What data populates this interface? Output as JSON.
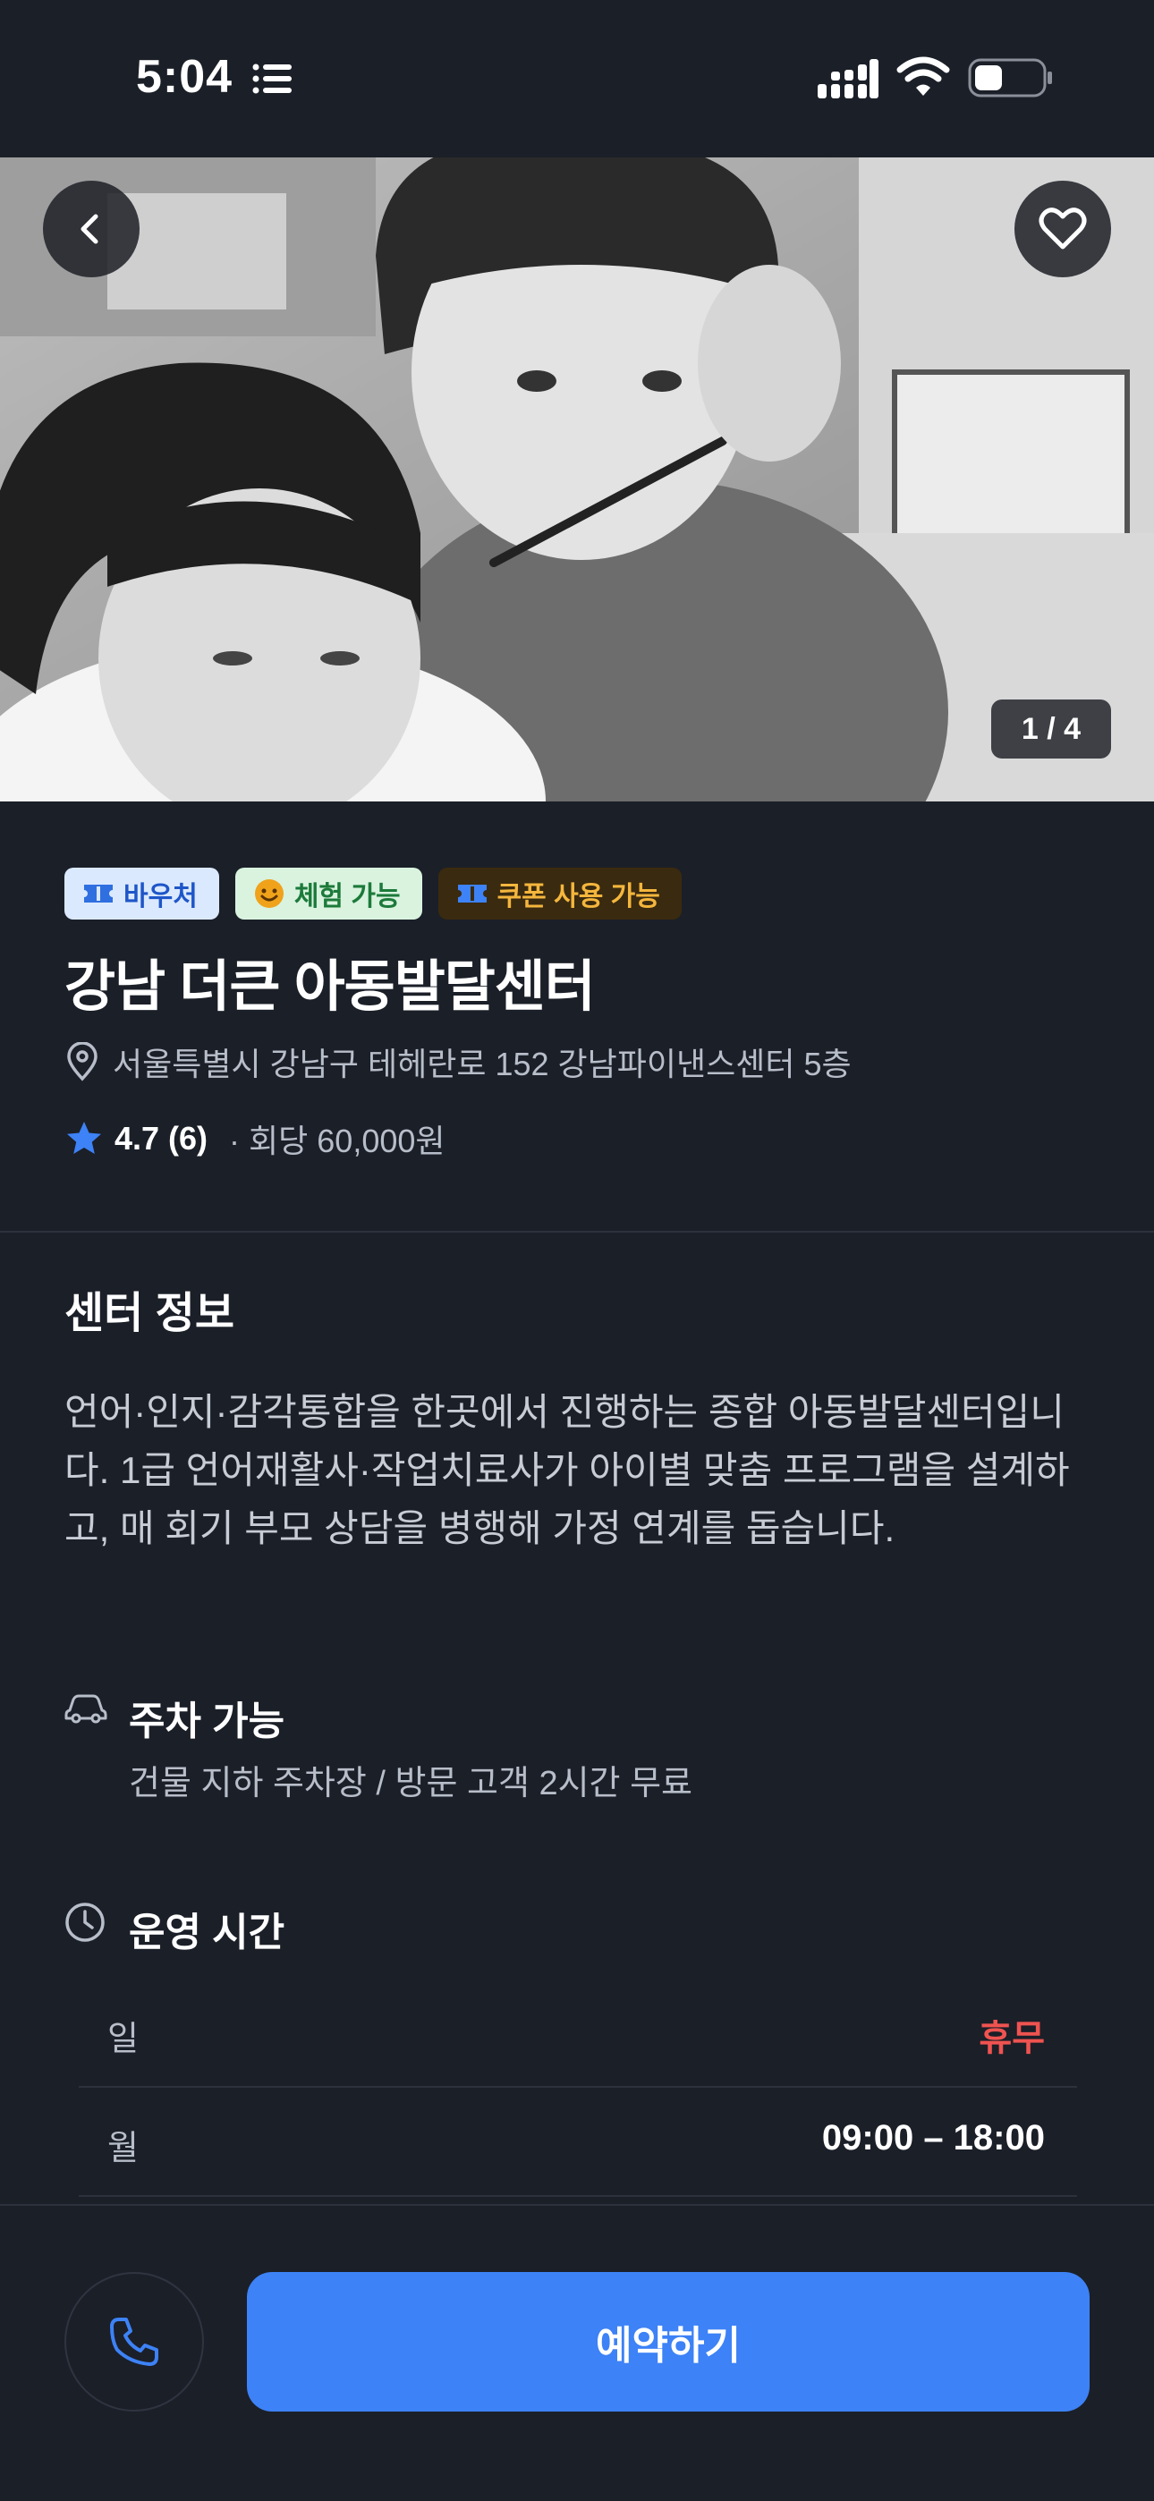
{
  "status_bar": {
    "time": "5:04"
  },
  "hero": {
    "image_alt": "Black-and-white photo of two children at a desk",
    "counter": "1 / 4"
  },
  "tags": [
    {
      "label": "바우처",
      "icon": "ticket-icon"
    },
    {
      "label": "체험 가능",
      "icon": "smile-icon"
    },
    {
      "label": "쿠폰 사용 가능",
      "icon": "coupon-icon"
    }
  ],
  "center": {
    "name": "강남 더큰 아동발달센터",
    "address": "서울특별시 강남구 테헤란로 152 강남파이낸스센터 5층",
    "rating": "4.7",
    "review_count": "(6)",
    "price": "· 회당 60,000원"
  },
  "info": {
    "section_title": "센터 정보",
    "description": "언어·인지·감각통합을 한곳에서 진행하는 종합 아동발달센터입니다. 1급 언어재활사·작업치료사가 아이별 맞춤 프로그램을 설계하고, 매 회기 부모 상담을 병행해 가정 연계를 돕습니다.",
    "parking_title": "주차 가능",
    "parking_desc": "건물 지하 주차장 / 방문 고객 2시간 무료",
    "hours_title": "운영 시간",
    "hours": [
      {
        "day": "일",
        "time": "휴무",
        "closed": true
      },
      {
        "day": "월",
        "time": "09:00 – 18:00",
        "closed": false
      }
    ]
  },
  "actions": {
    "reserve_label": "예약하기"
  },
  "colors": {
    "background": "#1b1f28",
    "accent": "#3d82f6",
    "closed": "#ef5350",
    "star": "#3d82f6"
  }
}
